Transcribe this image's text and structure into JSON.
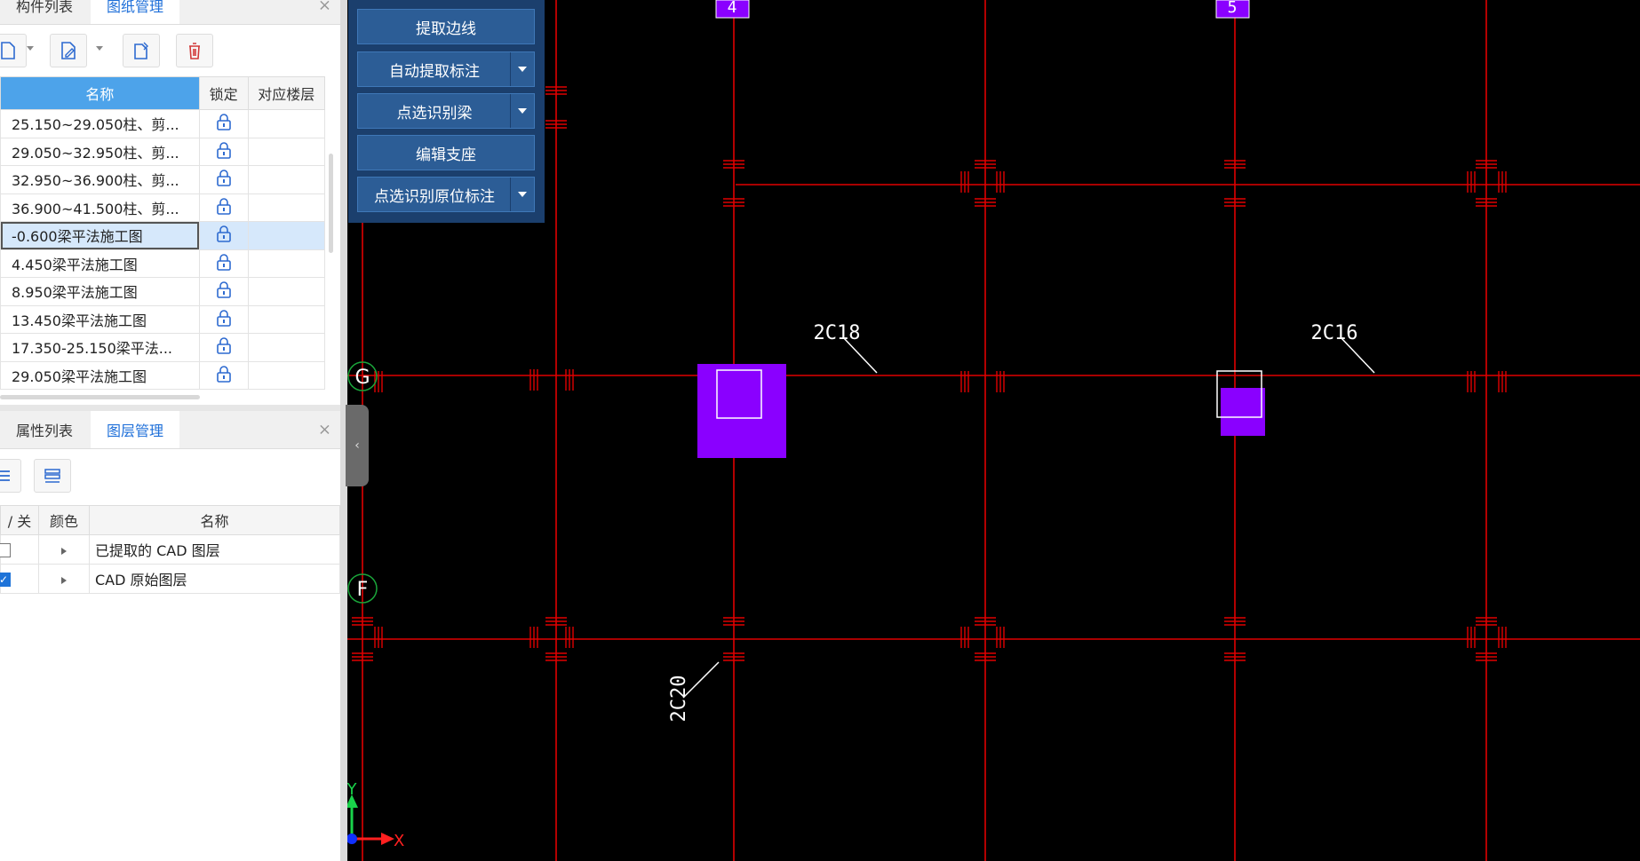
{
  "sheet_panel": {
    "tabs": [
      "构件列表",
      "图纸管理"
    ],
    "close": "×",
    "columns": {
      "name": "名称",
      "lock": "锁定",
      "floor": "对应楼层"
    },
    "rows": [
      "25.150~29.050柱、剪...",
      "29.050~32.950柱、剪...",
      "32.950~36.900柱、剪...",
      "36.900~41.500柱、剪...",
      "-0.600梁平法施工图",
      "4.450梁平法施工图",
      "8.950梁平法施工图",
      "13.450梁平法施工图",
      "17.350-25.150梁平法...",
      "29.050梁平法施工图"
    ],
    "selected_index": 4
  },
  "layer_panel": {
    "tabs": [
      "属性列表",
      "图层管理"
    ],
    "close": "×",
    "columns": {
      "toggle": "/ 关",
      "color": "颜色",
      "name": "名称"
    },
    "rows": [
      {
        "name": "已提取的 CAD 图层",
        "checked": false
      },
      {
        "name": "CAD 原始图层",
        "checked": true
      }
    ]
  },
  "cad_menu": {
    "buttons": [
      {
        "label": "提取边线",
        "dropdown": false
      },
      {
        "label": "自动提取标注",
        "dropdown": true
      },
      {
        "label": "点选识别梁",
        "dropdown": true
      },
      {
        "label": "编辑支座",
        "dropdown": false
      },
      {
        "label": "点选识别原位标注",
        "dropdown": true
      }
    ]
  },
  "drawing": {
    "axis_labels": {
      "col4": "4",
      "col5": "5",
      "rowG": "G",
      "rowF": "F"
    },
    "annotations": [
      "2C18",
      "2C16",
      "2C20"
    ],
    "ucs": {
      "x": "X",
      "y": "Y"
    },
    "colors": {
      "grid": "#e00000",
      "element": "#8a00ff",
      "axis_circle": "#1aa53a",
      "text": "#ffffff"
    }
  },
  "collapse_arrow": "‹"
}
